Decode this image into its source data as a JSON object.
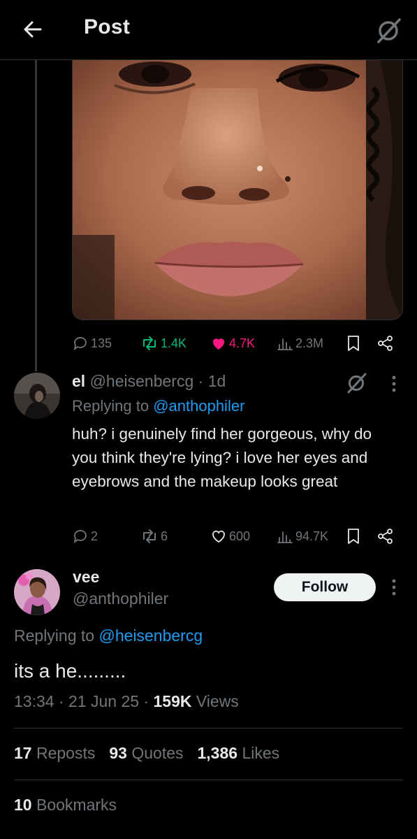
{
  "header": {
    "title": "Post"
  },
  "parent_post": {
    "actions": {
      "replies": "135",
      "reposts": "1.4K",
      "likes": "4.7K",
      "views": "2.3M"
    }
  },
  "reply": {
    "name": "el",
    "handle": "@heisenbercg",
    "time": "1d",
    "replying_prefix": "Replying to",
    "replying_to": "@anthophiler",
    "text": "huh? i genuinely find her gorgeous, why do you think they're lying? i love her eyes and eyebrows and the makeup looks great",
    "actions": {
      "replies": "2",
      "reposts": "6",
      "likes": "600",
      "views": "94.7K"
    }
  },
  "main_post": {
    "name": "vee",
    "handle": "@anthophiler",
    "follow_label": "Follow",
    "replying_prefix": "Replying to",
    "replying_to": "@heisenbercg",
    "text": "its a he.........",
    "time": "13:34",
    "date": "21 Jun 25",
    "views_count": "159K",
    "views_label": "Views",
    "stats": {
      "reposts_count": "17",
      "reposts_label": "Reposts",
      "quotes_count": "93",
      "quotes_label": "Quotes",
      "likes_count": "1,386",
      "likes_label": "Likes",
      "bookmarks_count": "10",
      "bookmarks_label": "Bookmarks"
    }
  },
  "colors": {
    "background": "#000000",
    "text": "#e7e9ea",
    "muted": "#71767b",
    "link": "#1d9bf0",
    "repost": "#00ba7c",
    "like": "#f91880"
  }
}
